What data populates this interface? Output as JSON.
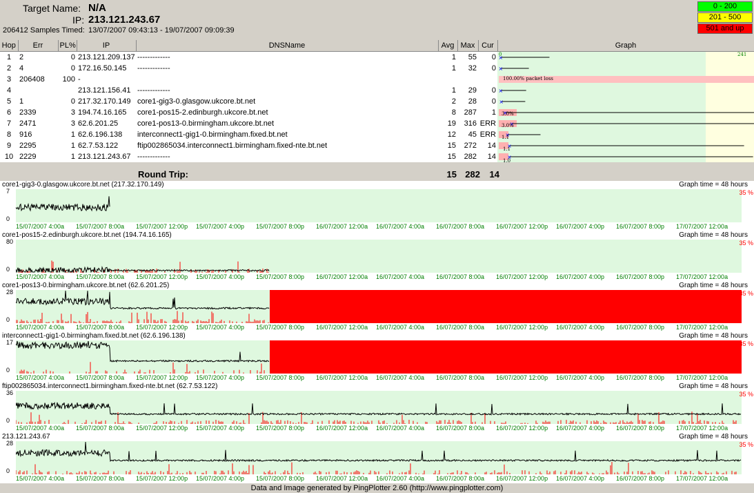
{
  "header": {
    "target_label": "Target Name:",
    "target_value": "N/A",
    "ip_label": "IP:",
    "ip_value": "213.121.243.67",
    "samples_label": "206412 Samples Timed:",
    "samples_range": "13/07/2007 09:43:13 - 19/07/2007 09:09:39"
  },
  "legend": [
    {
      "label": "0 - 200",
      "color": "#00ff00"
    },
    {
      "label": "201 - 500",
      "color": "#ffff00"
    },
    {
      "label": "501 and up",
      "color": "#ff0000"
    }
  ],
  "columns": [
    "Hop",
    "Err",
    "PL%",
    "IP",
    "DNSName",
    "Avg",
    "Max",
    "Cur",
    "Graph"
  ],
  "hops": [
    {
      "hop": "1",
      "err": "2",
      "pl": "0",
      "ip": "213.121.209.137",
      "dns": "-------------",
      "avg": "1",
      "max": "55",
      "cur": "0"
    },
    {
      "hop": "2",
      "err": "4",
      "pl": "0",
      "ip": "172.16.50.145",
      "dns": "-------------",
      "avg": "1",
      "max": "32",
      "cur": "0"
    },
    {
      "hop": "3",
      "err": "206408",
      "pl": "100",
      "ip": "-",
      "dns": "",
      "avg": "",
      "max": "",
      "cur": ""
    },
    {
      "hop": "4",
      "err": "",
      "pl": "",
      "ip": "213.121.156.41",
      "dns": "-------------",
      "avg": "1",
      "max": "29",
      "cur": "0"
    },
    {
      "hop": "5",
      "err": "1",
      "pl": "0",
      "ip": "217.32.170.149",
      "dns": "core1-gig3-0.glasgow.ukcore.bt.net",
      "avg": "2",
      "max": "28",
      "cur": "0"
    },
    {
      "hop": "6",
      "err": "2339",
      "pl": "3",
      "ip": "194.74.16.165",
      "dns": "core1-pos15-2.edinburgh.ukcore.bt.net",
      "avg": "8",
      "max": "287",
      "cur": "1"
    },
    {
      "hop": "7",
      "err": "2471",
      "pl": "3",
      "ip": "62.6.201.25",
      "dns": "core1-pos13-0.birmingham.ukcore.bt.net",
      "avg": "19",
      "max": "316",
      "cur": "ERR"
    },
    {
      "hop": "8",
      "err": "916",
      "pl": "1",
      "ip": "62.6.196.138",
      "dns": "interconnect1-gig1-0.birmingham.fixed.bt.net",
      "avg": "12",
      "max": "45",
      "cur": "ERR"
    },
    {
      "hop": "9",
      "err": "2295",
      "pl": "1",
      "ip": "62.7.53.122",
      "dns": "ftip002865034.interconnect1.birmingham.fixed-nte.bt.net",
      "avg": "15",
      "max": "272",
      "cur": "14"
    },
    {
      "hop": "10",
      "err": "2229",
      "pl": "1",
      "ip": "213.121.243.67",
      "dns": "-------------",
      "avg": "15",
      "max": "282",
      "cur": "14"
    }
  ],
  "graph_labels": {
    "zero": "0",
    "max": "241",
    "packet_loss": "100.00% packet loss",
    "pl6": "3.0%",
    "pl7": "3.0%",
    "pl8": "1.1",
    "pl9": "1.1",
    "pl10": "1.0"
  },
  "round_trip": {
    "label": "Round Trip:",
    "avg": "15",
    "max": "282",
    "cur": "14"
  },
  "graph_time": "Graph time = 48 hours",
  "pct_label": "35 %",
  "x_labels": [
    "15/07/2007 4:00a",
    "15/07/2007 8:00a",
    "15/07/2007 12:00p",
    "15/07/2007 4:00p",
    "15/07/2007 8:00p",
    "16/07/2007 12:00a",
    "16/07/2007 4:00a",
    "16/07/2007 8:00a",
    "16/07/2007 12:00p",
    "16/07/2007 4:00p",
    "16/07/2007 8:00p",
    "17/07/2007 12:00a"
  ],
  "charts": [
    {
      "title": "core1-gig3-0.glasgow.ukcore.bt.net (217.32.170.149)",
      "ymax": "7",
      "ymin": "0",
      "red_from": null,
      "data_end": 0.13,
      "base1": 0.55,
      "base2": 0.9,
      "loss": 0.0
    },
    {
      "title": "core1-pos15-2.edinburgh.ukcore.bt.net (194.74.16.165)",
      "ymax": "80",
      "ymin": "0",
      "red_from": null,
      "data_end": 0.35,
      "base1": 0.93,
      "base2": 0.93,
      "loss": 0.4
    },
    {
      "title": "core1-pos13-0.birmingham.ukcore.bt.net (62.6.201.25)",
      "ymax": "28",
      "ymin": "0",
      "red_from": 0.35,
      "data_end": 0.35,
      "base1": 0.35,
      "base2": 0.55,
      "loss": 0.6
    },
    {
      "title": "interconnect1-gig1-0.birmingham.fixed.bt.net (62.6.196.138)",
      "ymax": "17",
      "ymin": "0",
      "red_from": 0.35,
      "data_end": 0.35,
      "base1": 0.15,
      "base2": 0.62,
      "loss": 0.3
    },
    {
      "title": "ftip002865034.interconnect1.birmingham.fixed-nte.bt.net (62.7.53.122)",
      "ymax": "36",
      "ymin": "0",
      "red_from": null,
      "data_end": 1.0,
      "base1": 0.45,
      "base2": 0.7,
      "loss": 0.4
    },
    {
      "title": "213.121.243.67",
      "ymax": "28",
      "ymin": "0",
      "red_from": null,
      "data_end": 1.0,
      "base1": 0.35,
      "base2": 0.58,
      "loss": 0.45
    }
  ],
  "footer": "Data and Image generated by PingPlotter 2.60 (http://www.pingplotter.com)"
}
